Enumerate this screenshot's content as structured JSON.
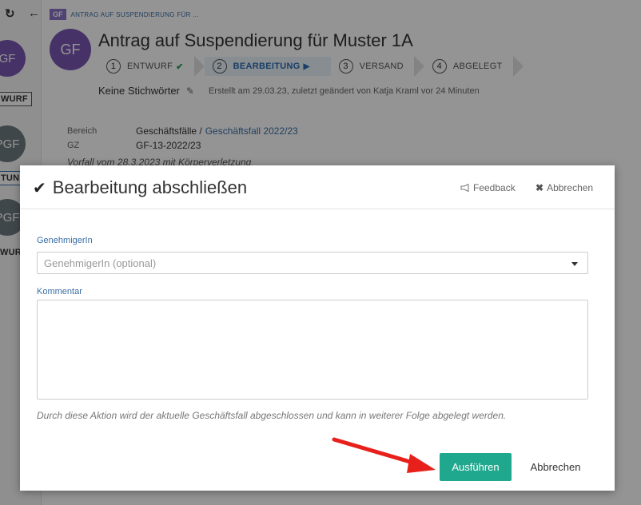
{
  "rail": {
    "refresh_icon": "↻",
    "back_icon": "←",
    "avatars": [
      "GF",
      "PGF",
      "PGF"
    ],
    "badges": [
      "WURF",
      "TUN",
      "WUR"
    ]
  },
  "header": {
    "breadcrumb_tag": "GF",
    "breadcrumb_text": "Antrag auf Suspendierung für ...",
    "avatar": "GF",
    "title": "Antrag auf Suspendierung für Muster 1A"
  },
  "steps": [
    {
      "num": "1",
      "label": "ENTWURF"
    },
    {
      "num": "2",
      "label": "BEARBEITUNG"
    },
    {
      "num": "3",
      "label": "VERSAND"
    },
    {
      "num": "4",
      "label": "ABGELEGT"
    }
  ],
  "meta": {
    "keywords": "Keine Stichwörter",
    "created": "Erstellt am 29.03.23, zuletzt geändert von Katja Kraml  vor 24 Minuten"
  },
  "info": {
    "bereich_label": "Bereich",
    "bereich_value": "Geschäftsfälle /",
    "bereich_link": "Geschäftsfall 2022/23",
    "gz_label": "GZ",
    "gz_value": "GF-13-2022/23",
    "vorfall": "Vorfall vom 28.3.2023 mit Körperverletzung"
  },
  "modal": {
    "title": "Bearbeitung abschließen",
    "feedback": "Feedback",
    "abort_top": "Abbrechen",
    "approver_label": "GenehmigerIn",
    "approver_placeholder": "GenehmigerIn (optional)",
    "comment_label": "Kommentar",
    "hint": "Durch diese Aktion wird der aktuelle Geschäftsfall abgeschlossen und kann in weiterer Folge abgelegt werden.",
    "submit": "Ausführen",
    "cancel": "Abbrechen"
  },
  "colors": {
    "accent": "#1fa88d",
    "avatar": "#7b57b3",
    "link": "#3a6ea5",
    "arrow": "#e8201c"
  }
}
